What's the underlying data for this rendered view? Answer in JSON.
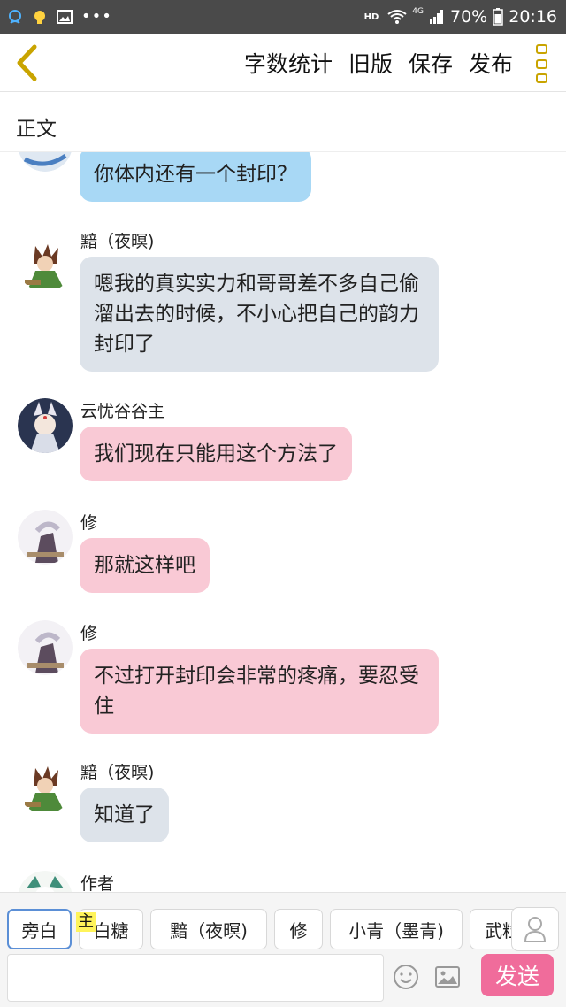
{
  "status_bar": {
    "hd": "HD",
    "network": "4G",
    "battery": "70%",
    "time": "20:16",
    "dots": "•••"
  },
  "header": {
    "actions": [
      "字数统计",
      "旧版",
      "保存",
      "发布"
    ]
  },
  "section": {
    "label": "正文"
  },
  "messages": [
    {
      "speaker": "",
      "text": "你体内还有一个封印？",
      "color": "#a8d8f5"
    },
    {
      "speaker": "黯（夜暝)",
      "text": "嗯我的真实实力和哥哥差不多自己偷溜出去的时候，不小心把自己的韵力封印了",
      "color": "#dde3ea"
    },
    {
      "speaker": "云忧谷谷主",
      "text": "我们现在只能用这个方法了",
      "color": "#f9c9d5"
    },
    {
      "speaker": "修",
      "text": "那就这样吧",
      "color": "#f9c9d5"
    },
    {
      "speaker": "修",
      "text": "不过打开封印会非常的疼痛，要忍受住",
      "color": "#f9c9d5"
    },
    {
      "speaker": "黯（夜暝)",
      "text": "知道了",
      "color": "#dde3ea"
    },
    {
      "speaker": "作者",
      "text": "",
      "color": ""
    }
  ],
  "roles": {
    "host_badge": "主",
    "items": [
      "旁白",
      "白糖",
      "黯（夜暝)",
      "修",
      "小青（墨青)",
      "武粒"
    ]
  },
  "input": {
    "value": "",
    "placeholder": "",
    "send_label": "发送"
  },
  "colors": {
    "accent": "#f06c9b",
    "back_arrow": "#c9a400",
    "status_bar": "#4a4a4a"
  }
}
